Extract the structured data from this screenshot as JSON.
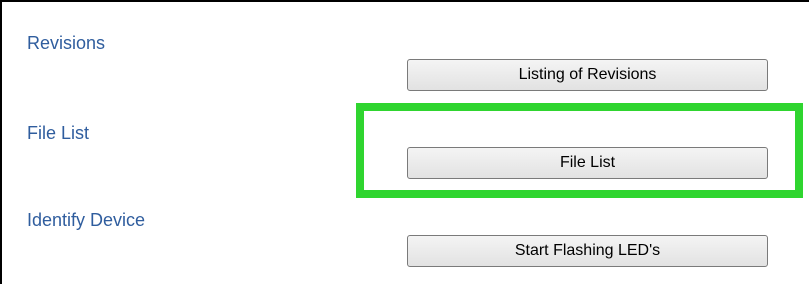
{
  "sections": [
    {
      "label": "Revisions",
      "button_label": "Listing of Revisions"
    },
    {
      "label": "File List",
      "button_label": "File List"
    },
    {
      "label": "Identify Device",
      "button_label": "Start Flashing LED's"
    }
  ],
  "highlight": {
    "color": "#2fd52f",
    "target": "File List"
  },
  "colors": {
    "label": "#2f5d9e",
    "border": "#000000"
  }
}
